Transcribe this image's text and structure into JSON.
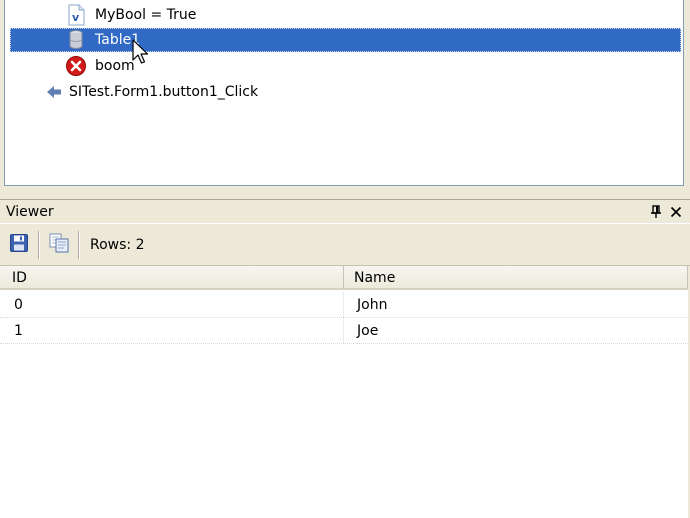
{
  "tree": {
    "items": [
      {
        "label": "MyBool = True",
        "icon": "variable-icon"
      },
      {
        "label": "Table1",
        "icon": "table-cylinder-icon",
        "selected": true
      },
      {
        "label": "boom",
        "icon": "error-icon"
      },
      {
        "label": "SITest.Form1.button1_Click",
        "icon": "arrow-left-icon"
      }
    ]
  },
  "viewer": {
    "title": "Viewer",
    "toolbar": {
      "save_icon": "save-icon",
      "copy_icon": "copy-icon",
      "rows_label": "Rows: 2"
    },
    "grid": {
      "columns": [
        "ID",
        "Name"
      ],
      "rows": [
        [
          "0",
          "John"
        ],
        [
          "1",
          "Joe"
        ]
      ]
    }
  },
  "colors": {
    "selection": "#316ac5",
    "chrome": "#ece9d8",
    "error_red": "#d11a1a"
  }
}
